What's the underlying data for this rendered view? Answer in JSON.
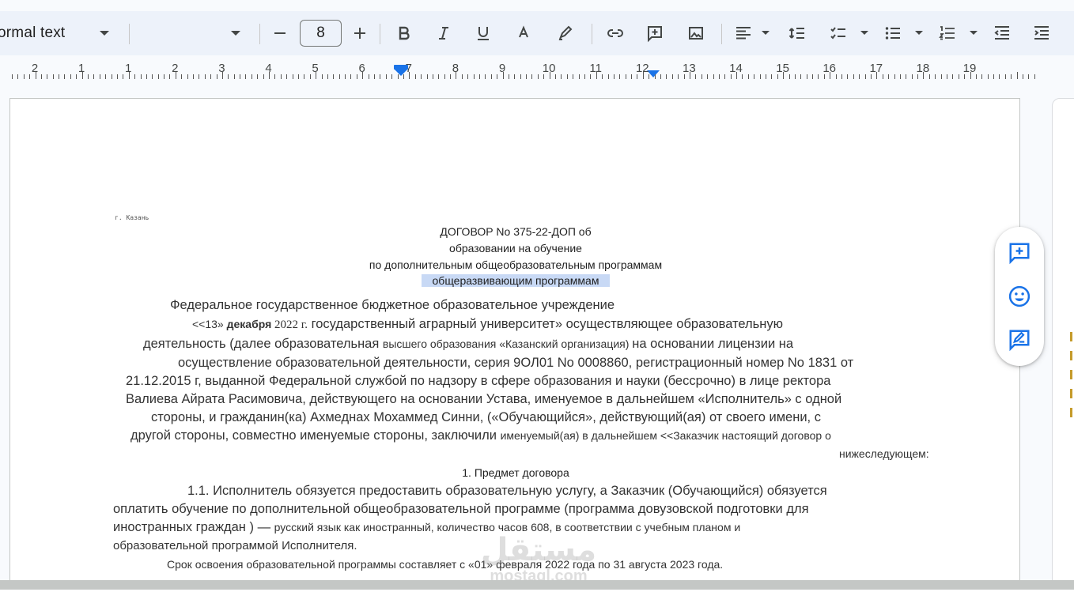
{
  "toolbar": {
    "style_label": "ormal text",
    "font_size": "8",
    "icons": [
      "minus-icon",
      "plus-icon",
      "bold-icon",
      "italic-icon",
      "underline-icon",
      "text-color-icon",
      "highlight-icon",
      "link-icon",
      "add-comment-icon",
      "insert-image-icon",
      "align-left-icon",
      "line-spacing-icon",
      "checklist-icon",
      "bulleted-list-icon",
      "numbered-list-icon",
      "decrease-indent-icon",
      "increase-indent-icon"
    ]
  },
  "ruler": {
    "numbers": [
      "2",
      "1",
      "1",
      "2",
      "3",
      "4",
      "5",
      "6",
      "7",
      "8",
      "9",
      "10",
      "11",
      "12",
      "13",
      "14",
      "15",
      "16",
      "17",
      "18",
      "19"
    ]
  },
  "document": {
    "city": "г. Казань",
    "title_1": "ДОГОВОР No 375-22-ДОП об",
    "title_2": "образовании на обучение",
    "title_3": "по дополнительным общеобразовательным программам",
    "title_4": "общеразвивающим программам",
    "p_institution": "Федеральное государственное бюджетное образовательное учреждение",
    "p_line1_a": "<<13» ",
    "p_line1_b": "декабря",
    "p_line1_c": " 2022 г.",
    "p_line1_d": "  государственный аграрный университет»  осуществляющее образовательную",
    "p_line2_a": "деятельность (далее образовательная ",
    "p_line2_b": "высшего образования «Казанский организация) ",
    "p_line2_c": "на  основании лицензии на",
    "p_line3": "осуществление образовательной деятельности, серия 9ОЛ01 No 0008860, регистрационный номер No 1831 от",
    "p_line4": "21.12.2015 г, выданной Федеральной службой по надзору в  сфере образования и науки  (бессрочно) в  лице ректора",
    "p_line5": "Валиева Айрата Расимовича, действующего на основании Устава, именуемое в дальнейшем «Исполнитель»  с одной",
    "p_line6": "стороны, и гражданин(ка) Ахмеднах Мохаммед Синни, («Обучающийся»,   действующий(ая)  от  своего имени, с",
    "p_line7_a": "другой стороны, совместно именуемые стороны, заключили ",
    "p_line7_b": "именуемый(ая) в дальнейшем <<Заказчик настоящий договор о",
    "p_line8": "нижеследующем:",
    "section_1": "1. Предмет договора",
    "s1_line1": "1.1. Исполнитель обязуется предоставить образовательную услугу, а Заказчик (Обучающийся) обязуется",
    "s1_line2": "оплатить обучение по  дополнительной общеобразовательной программе (программа довузовской подготовки для",
    "s1_line3_a": "иностранных граждан ) — ",
    "s1_line3_b": "русский язык как иностранный, количество часов 608, в соответствии с учебным планом и",
    "s1_line4": "образовательной программой Исполнителя.",
    "s1_line5": "Срок освоения образовательной программы составляет с «01» февраля 2022 года по 31 августа 2023 года."
  },
  "fab": {
    "icons": [
      "add-comment-icon",
      "emoji-reaction-icon",
      "suggest-edit-icon"
    ]
  },
  "watermark": {
    "arabic": "مستقل",
    "latin": "mostaql.com"
  },
  "colors": {
    "toolbar_bg": "#edf2fa",
    "page_bg": "#ffffff",
    "selection": "#c8d9f5",
    "accent_blue": "#1a73e8",
    "canvas_bg": "#f8fafd"
  }
}
